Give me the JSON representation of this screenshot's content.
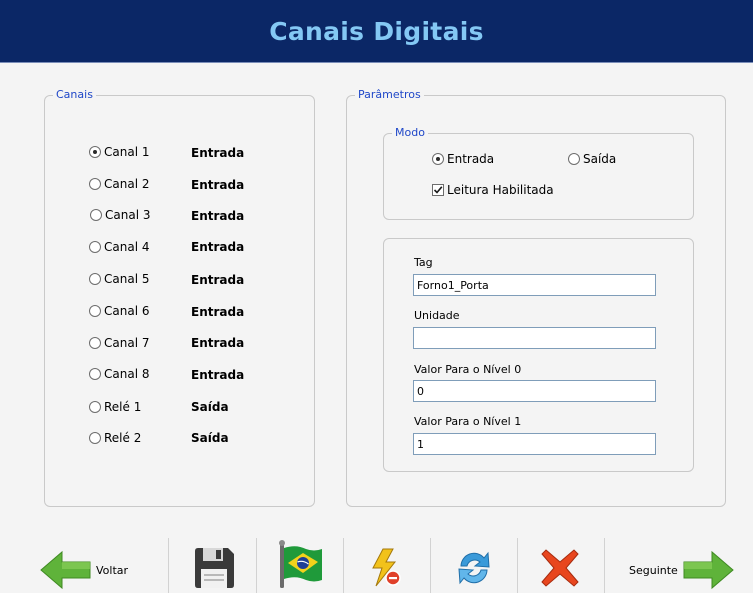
{
  "header": {
    "title": "Canais Digitais"
  },
  "channels_group": {
    "legend": "Canais",
    "items": [
      {
        "label": "Canal 1",
        "direction": "Entrada",
        "selected": true
      },
      {
        "label": "Canal 2",
        "direction": "Entrada",
        "selected": false
      },
      {
        "label": "Canal 3",
        "direction": "Entrada",
        "selected": false
      },
      {
        "label": "Canal 4",
        "direction": "Entrada",
        "selected": false
      },
      {
        "label": "Canal 5",
        "direction": "Entrada",
        "selected": false
      },
      {
        "label": "Canal 6",
        "direction": "Entrada",
        "selected": false
      },
      {
        "label": "Canal 7",
        "direction": "Entrada",
        "selected": false
      },
      {
        "label": "Canal 8",
        "direction": "Entrada",
        "selected": false
      },
      {
        "label": "Relé 1",
        "direction": "Saída",
        "selected": false
      },
      {
        "label": "Relé 2",
        "direction": "Saída",
        "selected": false
      }
    ]
  },
  "params_group": {
    "legend": "Parâmetros",
    "mode": {
      "legend": "Modo",
      "input_label": "Entrada",
      "output_label": "Saída",
      "selected": "Entrada",
      "read_enabled_label": "Leitura Habilitada",
      "read_enabled": true
    },
    "fields": {
      "tag_label": "Tag",
      "tag_value": "Forno1_Porta",
      "unit_label": "Unidade",
      "unit_value": "",
      "level0_label": "Valor Para o Nível 0",
      "level0_value": "0",
      "level1_label": "Valor Para o Nível 1",
      "level1_value": "1"
    }
  },
  "toolbar": {
    "back_label": "Voltar",
    "next_label": "Seguinte",
    "icons": [
      "back-arrow-icon",
      "save-icon",
      "brazil-flag-icon",
      "lightning-icon",
      "refresh-icon",
      "delete-icon",
      "next-arrow-icon"
    ],
    "colors": {
      "arrow_green": "#5fb33a",
      "delete_red": "#e8461e",
      "refresh_blue": "#3a9ad9"
    }
  }
}
